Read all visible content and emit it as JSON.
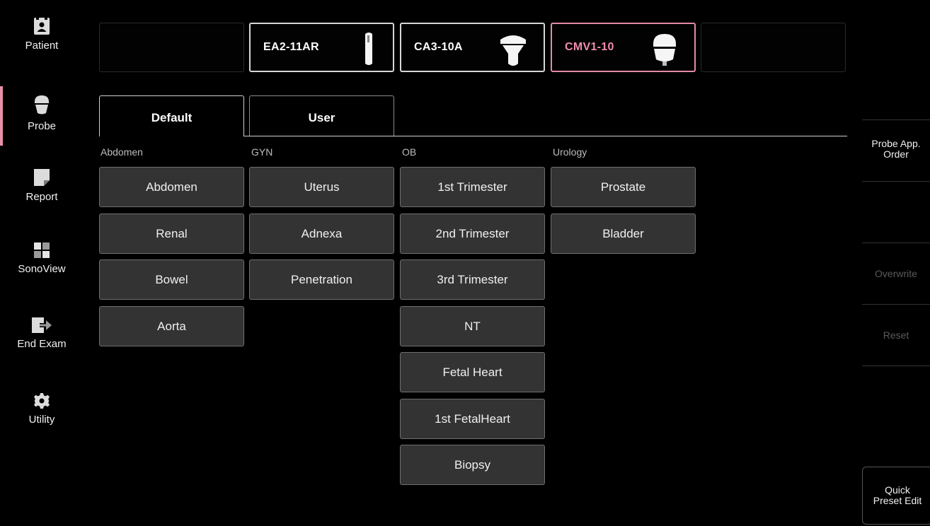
{
  "nav": {
    "items": [
      {
        "label": "Patient",
        "icon": "patient-icon"
      },
      {
        "label": "Probe",
        "icon": "probe-icon"
      },
      {
        "label": "Report",
        "icon": "report-icon"
      },
      {
        "label": "SonoView",
        "icon": "sonoview-icon"
      },
      {
        "label": "End Exam",
        "icon": "end-exam-icon"
      },
      {
        "label": "Utility",
        "icon": "gear-icon"
      }
    ],
    "active": "Probe"
  },
  "probes": {
    "slots": [
      {
        "name": "",
        "state": "empty"
      },
      {
        "name": "EA2-11AR",
        "state": "connected"
      },
      {
        "name": "CA3-10A",
        "state": "connected"
      },
      {
        "name": "CMV1-10",
        "state": "selected"
      },
      {
        "name": "",
        "state": "empty"
      }
    ]
  },
  "tabs": {
    "default_label": "Default",
    "user_label": "User",
    "active": "Default"
  },
  "categories": [
    {
      "label": "Abdomen",
      "presets": [
        "Abdomen",
        "Renal",
        "Bowel",
        "Aorta"
      ]
    },
    {
      "label": "GYN",
      "presets": [
        "Uterus",
        "Adnexa",
        "Penetration"
      ]
    },
    {
      "label": "OB",
      "presets": [
        "1st Trimester",
        "2nd Trimester",
        "3rd Trimester",
        "NT",
        "Fetal Heart",
        "1st FetalHeart",
        "Biopsy"
      ]
    },
    {
      "label": "Urology",
      "presets": [
        "Prostate",
        "Bladder"
      ]
    }
  ],
  "right_panel": {
    "probe_app_order_line1": "Probe App.",
    "probe_app_order_line2": "Order",
    "overwrite": "Overwrite",
    "reset": "Reset",
    "quick_line1": "Quick",
    "quick_line2": "Preset Edit"
  },
  "colors": {
    "accent": "#e58aa5",
    "button_bg": "#333333",
    "background": "#000000"
  }
}
